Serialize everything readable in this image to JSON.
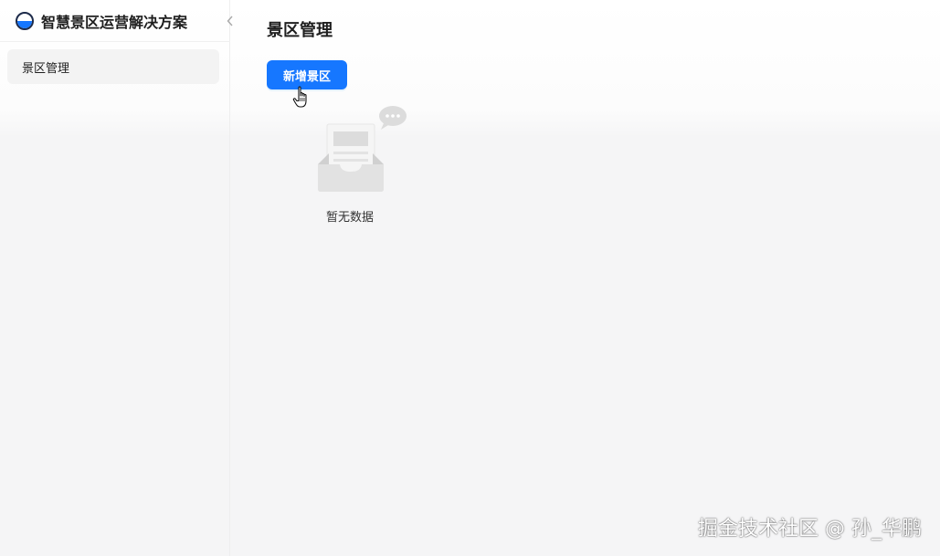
{
  "app": {
    "title": "智慧景区运营解决方案",
    "logo_icon": "globe-logo-icon",
    "collapse_icon": "chevron-left-icon"
  },
  "sidebar": {
    "items": [
      {
        "label": "景区管理",
        "active": true
      }
    ]
  },
  "main": {
    "title": "景区管理",
    "add_button_label": "新增景区",
    "empty_text": "暂无数据",
    "empty_icon": "empty-inbox-icon"
  },
  "watermark": "掘金技术社区 @ 孙_华鹏",
  "colors": {
    "primary": "#1677ff",
    "background": "#f5f5f6",
    "sidebar_active": "#f3f3f3"
  }
}
